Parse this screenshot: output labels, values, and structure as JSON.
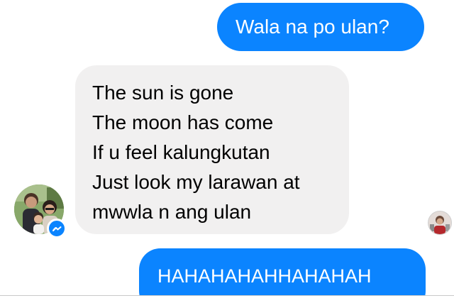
{
  "messages": {
    "outgoing_1": "Wala na po ulan?",
    "incoming_lines": [
      "The sun is gone",
      "The moon has come",
      "If u feel kalungkutan",
      "Just look my larawan at",
      "mwwla n ang ulan"
    ],
    "outgoing_2": "HAHAHAHAHHAHAHAH"
  },
  "colors": {
    "outgoing_bubble": "#0b84ff",
    "incoming_bubble": "#f1f0f0",
    "messenger_badge": "#0b84ff"
  },
  "icons": {
    "sender_avatar": "profile-photo",
    "messenger_badge": "messenger-icon",
    "read_receipt": "seen-avatar"
  }
}
